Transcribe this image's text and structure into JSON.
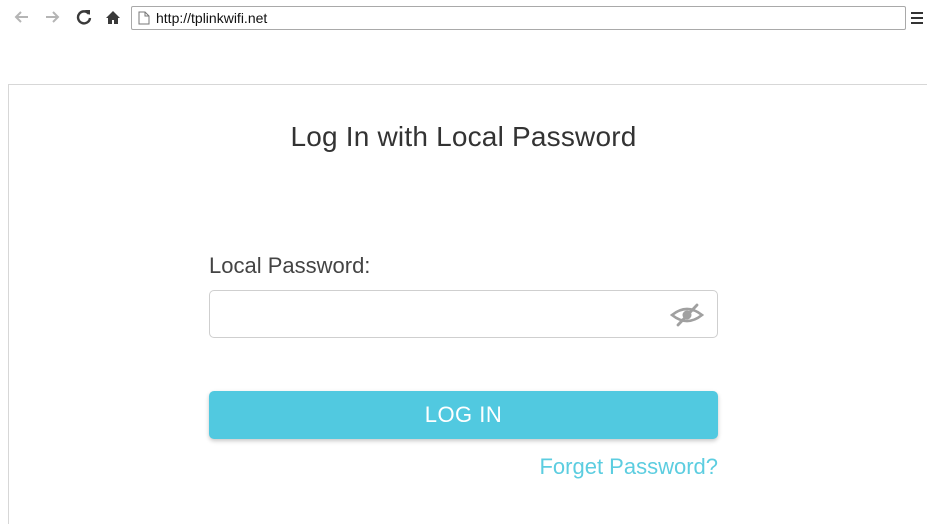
{
  "browser": {
    "url": "http://tplinkwifi.net"
  },
  "login": {
    "title": "Log In with Local Password",
    "password_label": "Local Password:",
    "password_value": "",
    "login_label": "LOG IN",
    "forget_label": "Forget Password?"
  },
  "icons": {
    "back": "arrow-left-icon",
    "forward": "arrow-right-icon",
    "reload": "reload-icon",
    "home": "home-icon",
    "page": "page-icon",
    "menu": "hamburger-menu-icon",
    "visibility": "eye-off-icon"
  },
  "colors": {
    "accent": "#51c9e0",
    "link": "#5ccde0",
    "title_text": "#333333"
  }
}
